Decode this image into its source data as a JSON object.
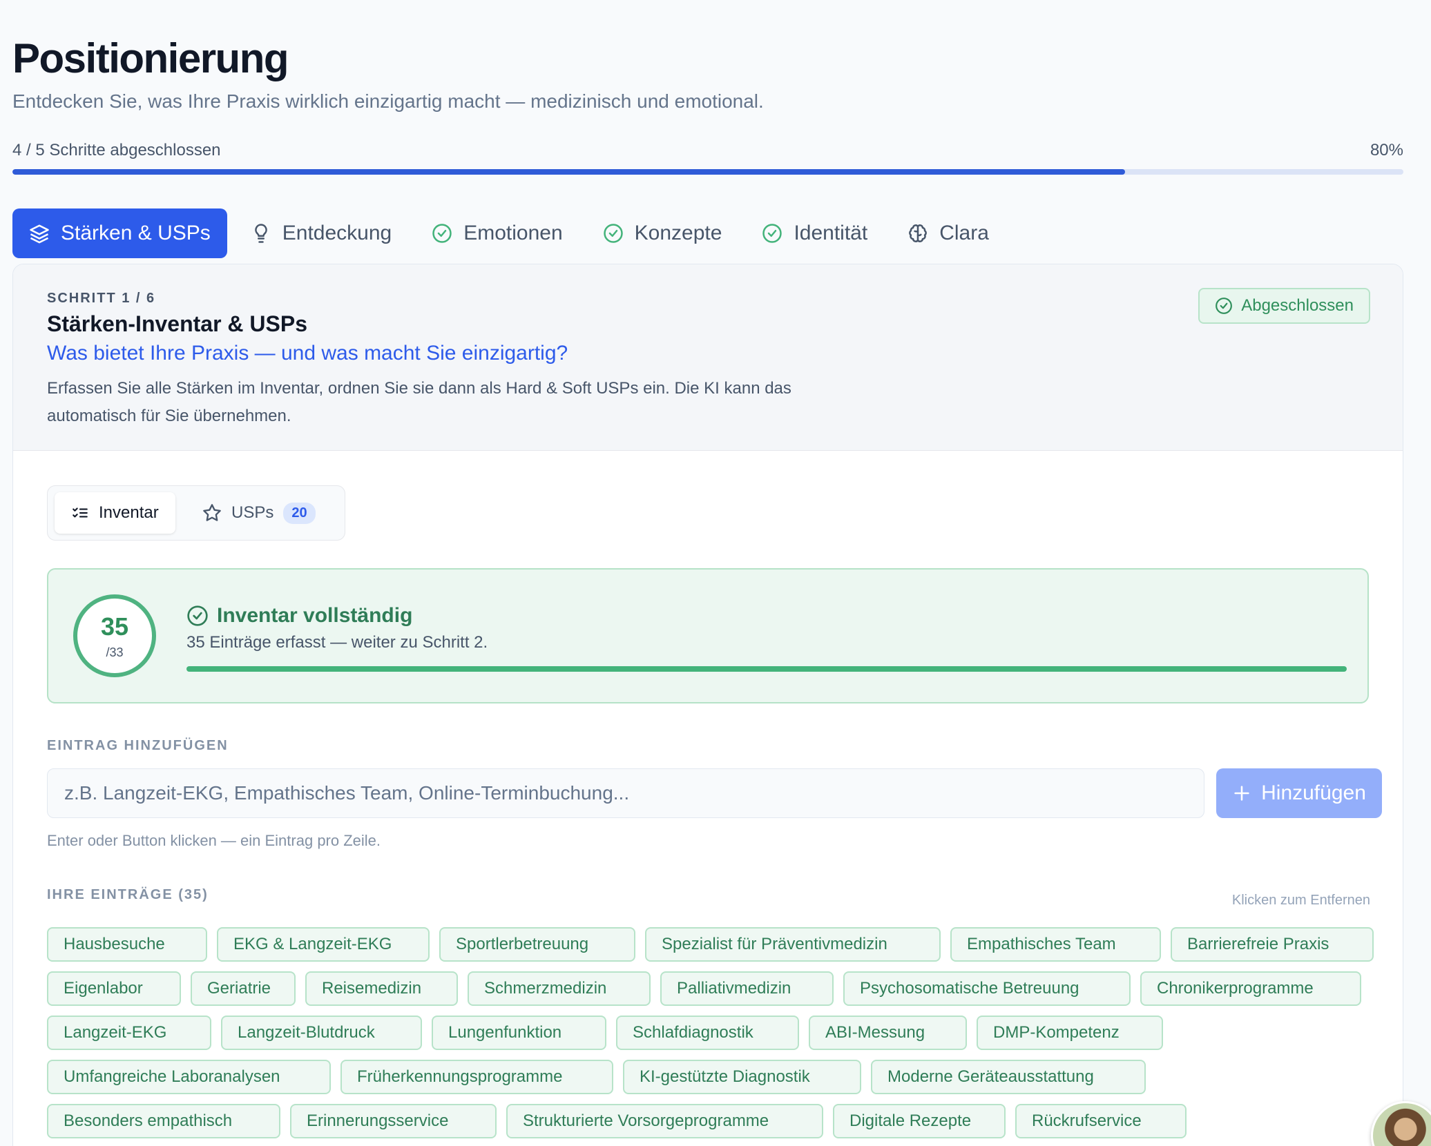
{
  "header": {
    "title": "Positionierung",
    "subtitle": "Entdecken Sie, was Ihre Praxis wirklich einzigartig macht — medizinisch und emotional.",
    "progress_label": "4 / 5 Schritte abgeschlossen",
    "progress_pct_label": "80%",
    "progress_value": 0.8
  },
  "tabs": [
    {
      "label": "Stärken & USPs",
      "icon": "layers-icon",
      "active": true
    },
    {
      "label": "Entdeckung",
      "icon": "lightbulb-icon"
    },
    {
      "label": "Emotionen",
      "icon": "check-circle-icon"
    },
    {
      "label": "Konzepte",
      "icon": "check-circle-icon"
    },
    {
      "label": "Identität",
      "icon": "check-circle-icon"
    },
    {
      "label": "Clara",
      "icon": "brain-icon"
    }
  ],
  "step": {
    "label": "SCHRITT 1 / 6",
    "title": "Stärken-Inventar & USPs",
    "question": "Was bietet Ihre Praxis — und was macht Sie einzigartig?",
    "description": "Erfassen Sie alle Stärken im Inventar, ordnen Sie sie dann als Hard & Soft USPs ein. Die KI kann das automatisch für Sie übernehmen.",
    "status": "Abgeschlossen"
  },
  "subtabs": {
    "inventar": "Inventar",
    "usps": "USPs",
    "usps_count": "20"
  },
  "inventory": {
    "count": "35",
    "target": "/33",
    "title": "Inventar vollständig",
    "subtitle": "35 Einträge erfasst — weiter zu Schritt 2.",
    "fill": 1.0
  },
  "add_entry": {
    "label": "EINTRAG HINZUFÜGEN",
    "placeholder": "z.B. Langzeit-EKG, Empathisches Team, Online-Terminbuchung...",
    "button": "Hinzufügen",
    "hint": "Enter oder Button klicken — ein Eintrag pro Zeile."
  },
  "entries": {
    "label": "IHRE EINTRÄGE (35)",
    "hint": "Klicken zum Entfernen",
    "items": [
      "Hausbesuche",
      "EKG & Langzeit-EKG",
      "Sportlerbetreuung",
      "Spezialist für Präventivmedizin",
      "Empathisches Team",
      "Barrierefreie Praxis",
      "Eigenlabor",
      "Geriatrie",
      "Reisemedizin",
      "Schmerzmedizin",
      "Palliativmedizin",
      "Psychosomatische Betreuung",
      "Chronikerprogramme",
      "Langzeit-EKG",
      "Langzeit-Blutdruck",
      "Lungenfunktion",
      "Schlafdiagnostik",
      "ABI-Messung",
      "DMP-Kompetenz",
      "Umfangreiche Laboranalysen",
      "Früherkennungsprogramme",
      "KI-gestützte Diagnostik",
      "Moderne Geräteausstattung",
      "Besonders empathisch",
      "Erinnerungsservice",
      "Strukturierte Vorsorgeprogramme",
      "Digitale Rezepte",
      "Rückrufservice"
    ]
  },
  "colors": {
    "accent": "#2d5bea",
    "success": "#2f8f5b",
    "success_bg": "#ecf7f1"
  }
}
